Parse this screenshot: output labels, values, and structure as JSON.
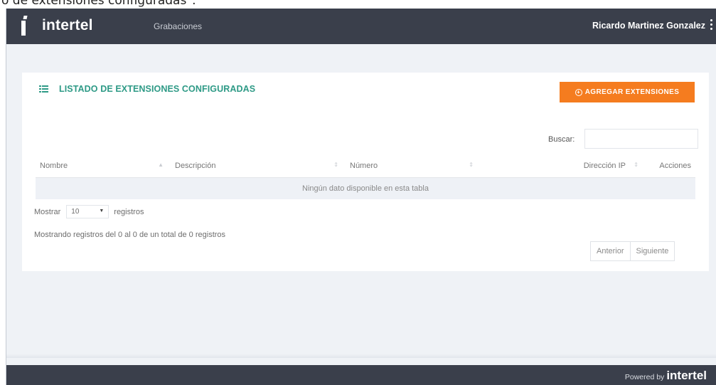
{
  "caption": "o de extensiones configuradas\".",
  "header": {
    "brand": "intertel",
    "nav_link": "Grabaciones",
    "user_name": "Ricardo Martinez Gonzalez"
  },
  "card": {
    "title": "LISTADO DE EXTENSIONES CONFIGURADAS",
    "add_button": "AGREGAR EXTENSIONES",
    "search_label": "Buscar:",
    "search_value": "",
    "columns": [
      "Nombre",
      "Descripción",
      "Número",
      "Dirección IP",
      "Acciones"
    ],
    "empty_message": "Ningún dato disponible en esta tabla",
    "length_prefix": "Mostrar",
    "length_value": "10",
    "length_suffix": "registros",
    "info": "Mostrando registros del 0 al 0 de un total de 0 registros",
    "prev": "Anterior",
    "next": "Siguiente"
  },
  "footer": {
    "powered_by": "Powered by",
    "brand": "intertel"
  },
  "colors": {
    "topbar": "#3a3f4b",
    "accent_teal": "#2e9a86",
    "accent_orange": "#f57c1f",
    "page_bg": "#eff2f6"
  }
}
